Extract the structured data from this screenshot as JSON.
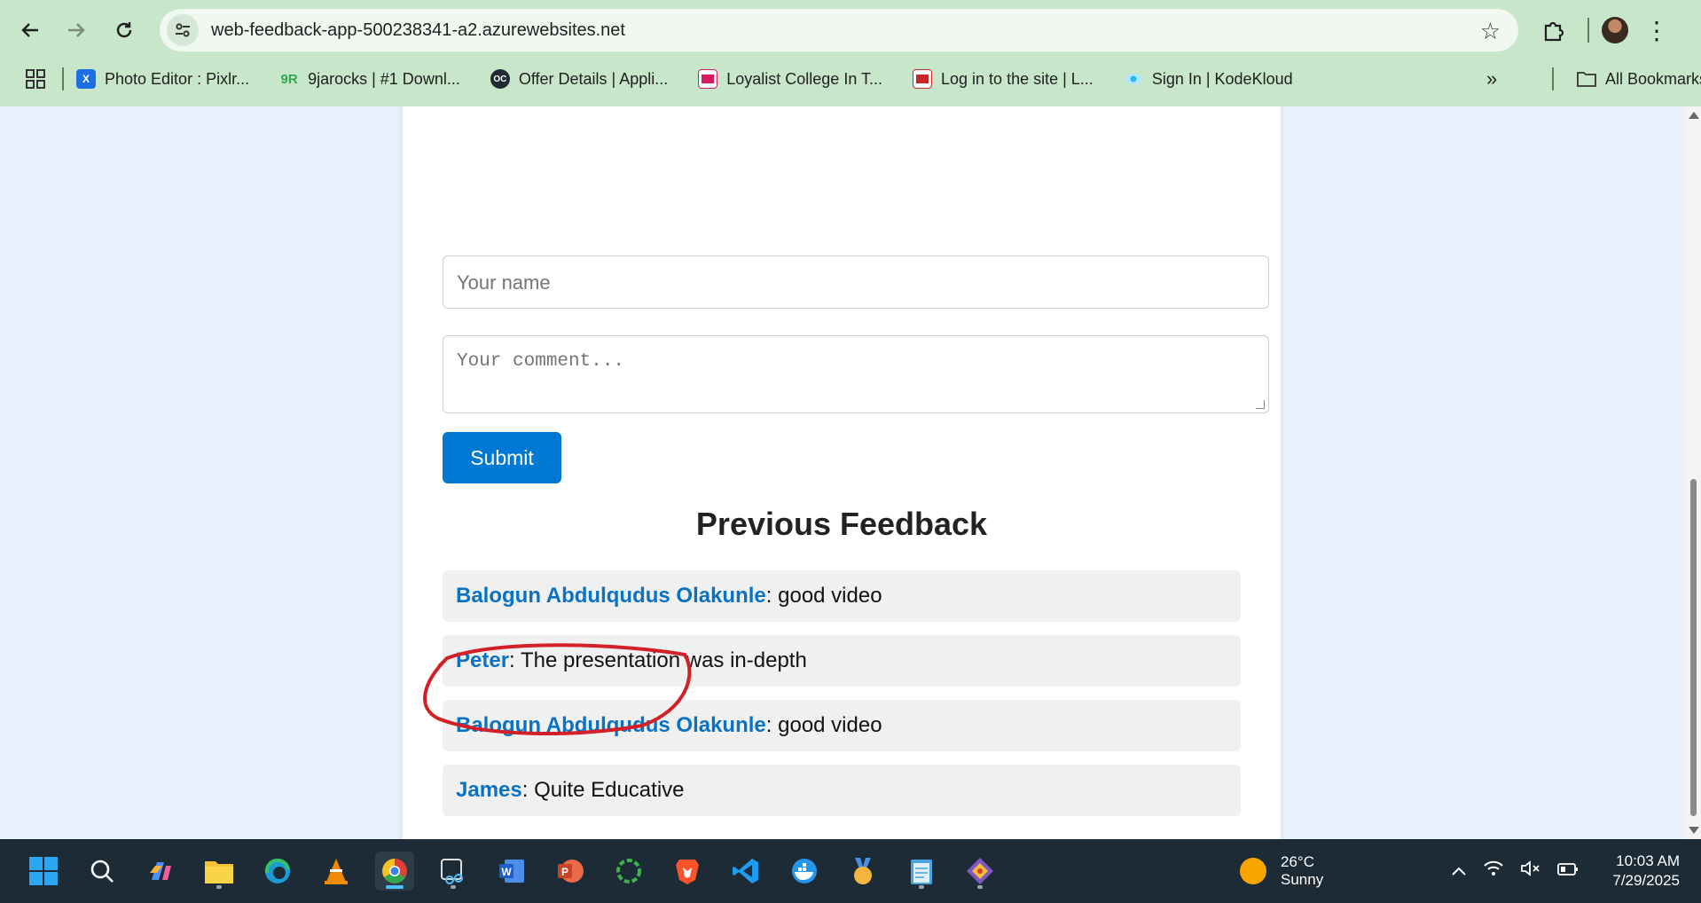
{
  "browser": {
    "url": "web-feedback-app-500238341-a2.azurewebsites.net",
    "bookmarks": [
      {
        "label": "Photo Editor : Pixlr...",
        "icon": "pixlr-icon",
        "color": "#1b6fe0"
      },
      {
        "label": "9jarocks | #1 Downl...",
        "icon": "9jarocks-icon",
        "color": "#2fa84f"
      },
      {
        "label": "Offer Details | Appli...",
        "icon": "oc-icon",
        "color": "#1f2a33"
      },
      {
        "label": "Loyalist College In T...",
        "icon": "loyalist-icon",
        "color": "#d81b60"
      },
      {
        "label": "Log in to the site | L...",
        "icon": "loyalist-login-icon",
        "color": "#c62828"
      },
      {
        "label": "Sign In | KodeKloud",
        "icon": "kodekloud-icon",
        "color": "#29b6f6"
      }
    ],
    "all_bookmarks_label": "All Bookmarks"
  },
  "form": {
    "name_placeholder": "Your name",
    "comment_placeholder": "Your comment...",
    "submit_label": "Submit"
  },
  "feedback": {
    "title": "Previous Feedback",
    "items": [
      {
        "name": "Balogun Abdulqudus Olakunle",
        "comment": ": good video"
      },
      {
        "name": "Peter",
        "comment": ": The presentation was in-depth"
      },
      {
        "name": "Balogun Abdulqudus Olakunle",
        "comment": ": good video"
      },
      {
        "name": "James",
        "comment": ": Quite Educative"
      }
    ]
  },
  "taskbar": {
    "weather_temp": "26°C",
    "weather_desc": "Sunny",
    "time": "10:03 AM",
    "date": "7/29/2025"
  },
  "colors": {
    "accent": "#0078d4",
    "feedback_name": "#0a72c4",
    "annotation": "#d32027",
    "chrome_bg": "#c8e6c9"
  }
}
